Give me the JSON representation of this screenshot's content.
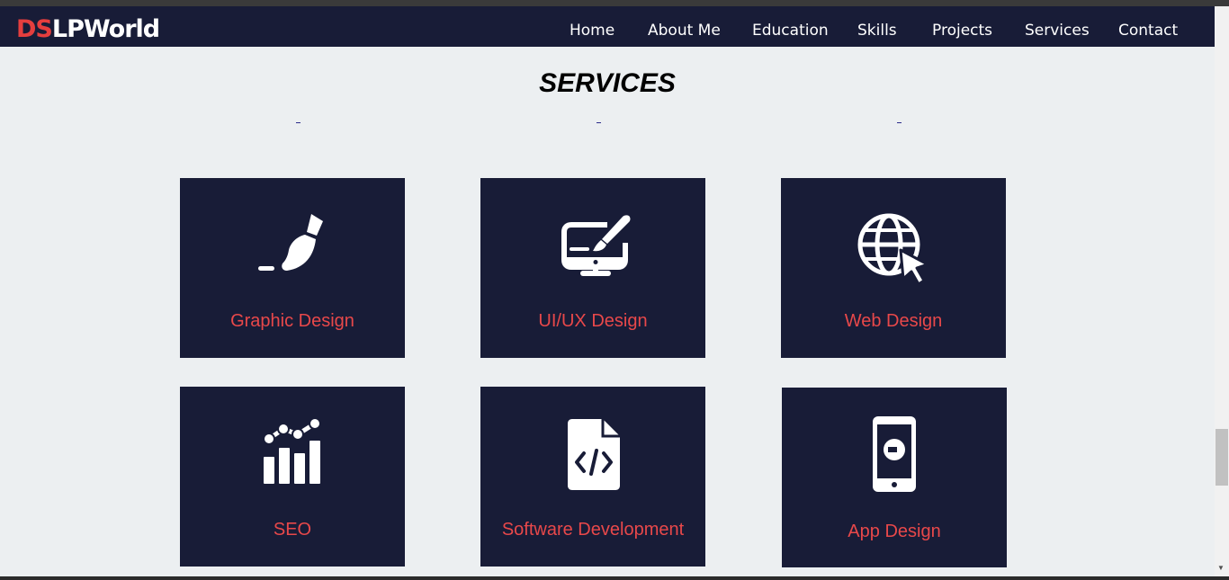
{
  "logo": {
    "prefix": "DS",
    "suffix": "LPWorld"
  },
  "nav": [
    "Home",
    "About Me",
    "Education",
    "Skills",
    "Projects",
    "Services",
    "Contact"
  ],
  "section_title": "SERVICES",
  "services": [
    {
      "label": "Graphic Design",
      "icon": "paintbrush-icon"
    },
    {
      "label": "UI/UX Design",
      "icon": "monitor-pen-icon"
    },
    {
      "label": "Web Design",
      "icon": "globe-cursor-icon"
    },
    {
      "label": "SEO",
      "icon": "chart-line-icon"
    },
    {
      "label": "Software Development",
      "icon": "code-file-icon"
    },
    {
      "label": "App Design",
      "icon": "mobile-phone-icon"
    }
  ],
  "colors": {
    "navy": "#181c37",
    "accent": "#e8484a",
    "background": "#eceff1"
  }
}
